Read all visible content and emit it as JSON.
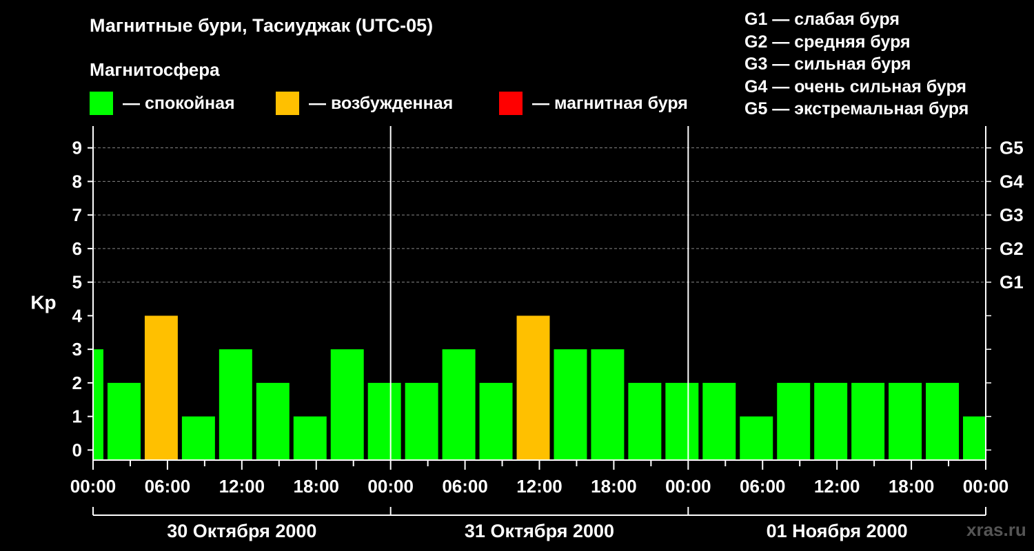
{
  "title": "Магнитные бури, Тасиуджак (UTC-05)",
  "legend": {
    "heading": "Магнитосфера",
    "items": [
      {
        "label": "— спокойная",
        "color": "#00ff00"
      },
      {
        "label": "— возбужденная",
        "color": "#ffc000"
      },
      {
        "label": "— магнитная буря",
        "color": "#ff0000"
      }
    ]
  },
  "g_legend": [
    "G1 — слабая буря",
    "G2 — средняя буря",
    "G3 — сильная буря",
    "G4 — очень сильная буря",
    "G5 — экстремальная буря"
  ],
  "watermark": "xras.ru",
  "chart_data": {
    "type": "bar",
    "ylabel": "Kp",
    "ylim": [
      0,
      9
    ],
    "y_ticks": [
      0,
      1,
      2,
      3,
      4,
      5,
      6,
      7,
      8,
      9
    ],
    "right_ticks": [
      {
        "y": 5,
        "label": "G1"
      },
      {
        "y": 6,
        "label": "G2"
      },
      {
        "y": 7,
        "label": "G3"
      },
      {
        "y": 8,
        "label": "G4"
      },
      {
        "y": 9,
        "label": "G5"
      }
    ],
    "grid_y": [
      5,
      6,
      7,
      8,
      9
    ],
    "x_tick_labels": [
      "00:00",
      "06:00",
      "12:00",
      "18:00",
      "00:00",
      "06:00",
      "12:00",
      "18:00",
      "00:00",
      "06:00",
      "12:00",
      "18:00",
      "00:00"
    ],
    "x_tick_hours": [
      0,
      6,
      12,
      18,
      24,
      30,
      36,
      42,
      48,
      54,
      60,
      66,
      72
    ],
    "day_separators_hours": [
      24,
      48
    ],
    "days": [
      "30 Октября 2000",
      "31 Октября 2000",
      "01 Ноября 2000"
    ],
    "x_range_hours": [
      0,
      72
    ],
    "bars": [
      {
        "start": 0,
        "end": 1,
        "kp": 3
      },
      {
        "start": 1,
        "end": 4,
        "kp": 2
      },
      {
        "start": 4,
        "end": 7,
        "kp": 4
      },
      {
        "start": 7,
        "end": 10,
        "kp": 1
      },
      {
        "start": 10,
        "end": 13,
        "kp": 3
      },
      {
        "start": 13,
        "end": 16,
        "kp": 2
      },
      {
        "start": 16,
        "end": 19,
        "kp": 1
      },
      {
        "start": 19,
        "end": 22,
        "kp": 3
      },
      {
        "start": 22,
        "end": 25,
        "kp": 2
      },
      {
        "start": 25,
        "end": 28,
        "kp": 2
      },
      {
        "start": 28,
        "end": 31,
        "kp": 3
      },
      {
        "start": 31,
        "end": 34,
        "kp": 2
      },
      {
        "start": 34,
        "end": 37,
        "kp": 4
      },
      {
        "start": 37,
        "end": 40,
        "kp": 3
      },
      {
        "start": 40,
        "end": 43,
        "kp": 3
      },
      {
        "start": 43,
        "end": 46,
        "kp": 2
      },
      {
        "start": 46,
        "end": 49,
        "kp": 2
      },
      {
        "start": 49,
        "end": 52,
        "kp": 2
      },
      {
        "start": 52,
        "end": 55,
        "kp": 1
      },
      {
        "start": 55,
        "end": 58,
        "kp": 2
      },
      {
        "start": 58,
        "end": 61,
        "kp": 2
      },
      {
        "start": 61,
        "end": 64,
        "kp": 2
      },
      {
        "start": 64,
        "end": 67,
        "kp": 2
      },
      {
        "start": 67,
        "end": 70,
        "kp": 2
      },
      {
        "start": 70,
        "end": 72,
        "kp": 1
      }
    ],
    "thresholds": {
      "active": 4,
      "storm": 5
    },
    "colors": {
      "quiet": "#00ff00",
      "active": "#ffc000",
      "storm": "#ff0000",
      "grid": "#888888",
      "axis": "#ffffff"
    }
  }
}
